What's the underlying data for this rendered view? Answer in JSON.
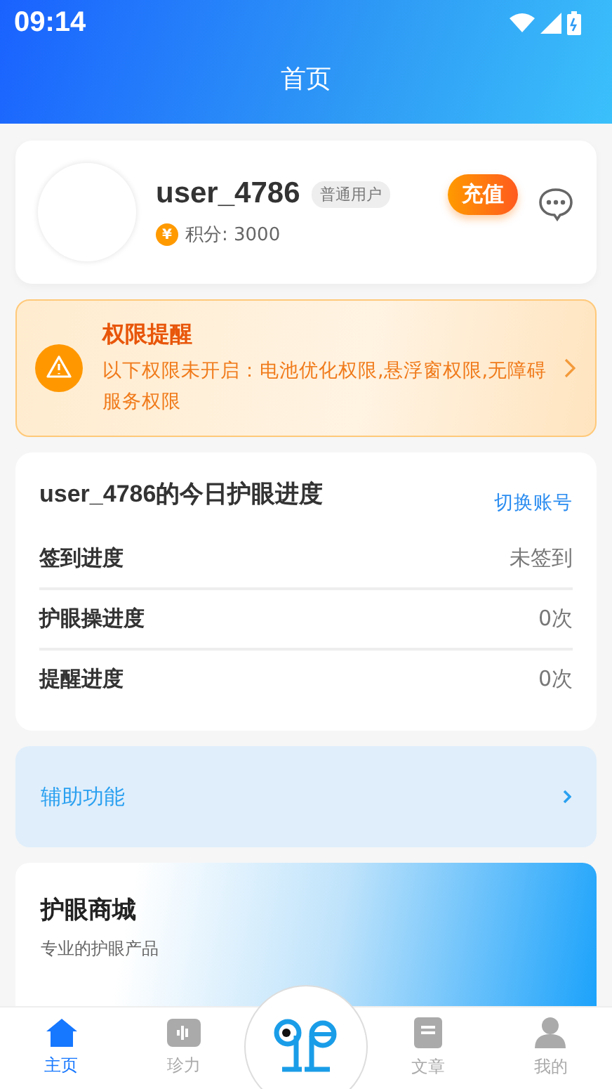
{
  "status_bar": {
    "time": "09:14"
  },
  "header": {
    "title": "首页"
  },
  "profile": {
    "username": "user_4786",
    "badge": "普通用户",
    "coin_symbol": "¥",
    "points": "积分: 3000",
    "recharge_button": "充值"
  },
  "permission_alert": {
    "title": "权限提醒",
    "message": "以下权限未开启：电池优化权限,悬浮窗权限,无障碍服务权限"
  },
  "progress": {
    "title": "user_4786的今日护眼进度",
    "switch_link": "切换账号",
    "rows": [
      {
        "label": "签到进度",
        "value": "未签到"
      },
      {
        "label": "护眼操进度",
        "value": "0次"
      },
      {
        "label": "提醒进度",
        "value": "0次"
      }
    ]
  },
  "assist": {
    "label": "辅助功能"
  },
  "shop": {
    "title": "护眼商城",
    "subtitle": "专业的护眼产品"
  },
  "tab_bar": {
    "items": [
      {
        "kind": "tab",
        "label": "主页",
        "selected": true
      },
      {
        "kind": "tab",
        "label": "珍力",
        "selected": false
      },
      {
        "kind": "center"
      },
      {
        "kind": "tab",
        "label": "文章",
        "selected": false
      },
      {
        "kind": "tab",
        "label": "我的",
        "selected": false
      }
    ]
  }
}
